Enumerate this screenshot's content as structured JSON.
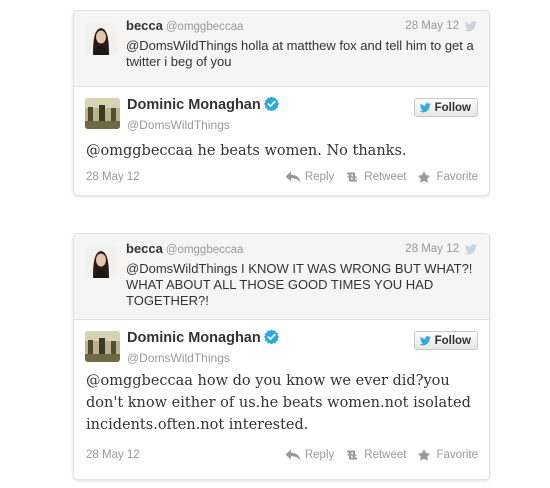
{
  "tweets": [
    {
      "context": {
        "name": "becca",
        "handle": "@omggbeccaa",
        "date": "28 May 12",
        "text": "@DomsWildThings holla at matthew fox and tell him to get a twitter i beg of you"
      },
      "main": {
        "name": "Dominic Monaghan",
        "handle": "@DomsWildThings",
        "follow_label": "Follow",
        "text": "@omggbeccaa he beats women. No thanks.",
        "date": "28 May 12",
        "reply_label": "Reply",
        "retweet_label": "Retweet",
        "favorite_label": "Favorite"
      }
    },
    {
      "context": {
        "name": "becca",
        "handle": "@omggbeccaa",
        "date": "28 May 12",
        "text": "@DomsWildThings I KNOW IT WAS WRONG BUT WHAT?! WHAT ABOUT ALL THOSE GOOD TIMES YOU HAD TOGETHER?!"
      },
      "main": {
        "name": "Dominic Monaghan",
        "handle": "@DomsWildThings",
        "follow_label": "Follow",
        "text": "@omggbeccaa how do you know we ever did?you don't know either of us.he beats women.not isolated incidents.often.not interested.",
        "date": "28 May 12",
        "reply_label": "Reply",
        "retweet_label": "Retweet",
        "favorite_label": "Favorite"
      }
    }
  ],
  "colors": {
    "verified": "#2aa9e0",
    "twitter_bird": "#33a9e0",
    "muted_text": "#999999",
    "context_bg": "#f5f5f5"
  },
  "icons": {
    "bird": "twitter-bird-icon",
    "verified": "verified-badge-icon",
    "reply": "reply-arrow-icon",
    "retweet": "retweet-icon",
    "favorite": "star-icon"
  }
}
